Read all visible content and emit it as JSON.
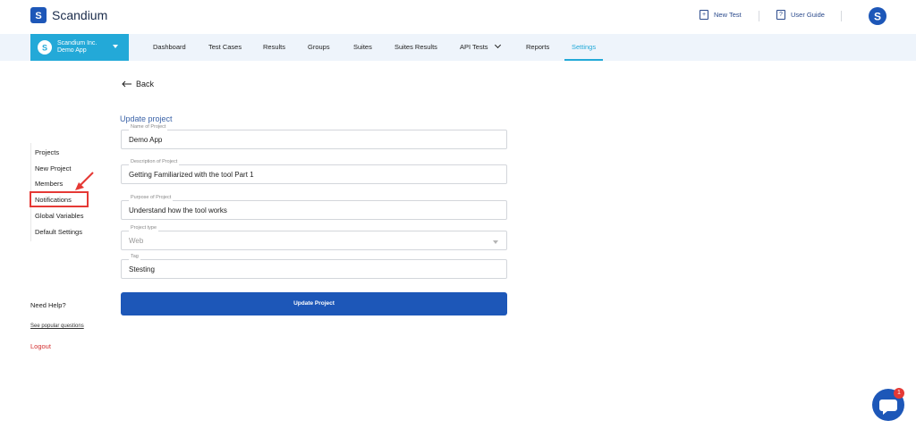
{
  "header": {
    "brand": "Scandium",
    "new_test": "New Test",
    "user_guide": "User Guide"
  },
  "project_selector": {
    "name": "Scandium Inc.",
    "subtitle": "Demo App"
  },
  "nav": {
    "items": [
      "Dashboard",
      "Test Cases",
      "Results",
      "Groups",
      "Suites",
      "Suites Results",
      "API Tests",
      "Reports",
      "Settings"
    ],
    "active": "Settings"
  },
  "sidebar": {
    "items": [
      "Projects",
      "New Project",
      "Members",
      "Notifications",
      "Global Variables",
      "Default Settings"
    ],
    "highlighted": "Notifications"
  },
  "help": {
    "title": "Need Help?",
    "link": "See popular questions",
    "logout": "Logout"
  },
  "form": {
    "back": "Back",
    "title": "Update project",
    "fields": [
      {
        "label": "Name of Project",
        "value": "Demo App"
      },
      {
        "label": "Description of Project",
        "value": "Getting Familiarized with the tool Part 1"
      },
      {
        "label": "Purpose of Project",
        "value": "Understand how the tool works"
      },
      {
        "label": "Project type",
        "value": "Web"
      },
      {
        "label": "Tag",
        "value": "Stesting"
      }
    ],
    "submit": "Update Project"
  },
  "chat": {
    "badge": "1"
  },
  "colors": {
    "primary": "#1d57b8",
    "accent": "#23a9d8",
    "danger": "#e53935",
    "nav_bg": "#eef4fb"
  }
}
